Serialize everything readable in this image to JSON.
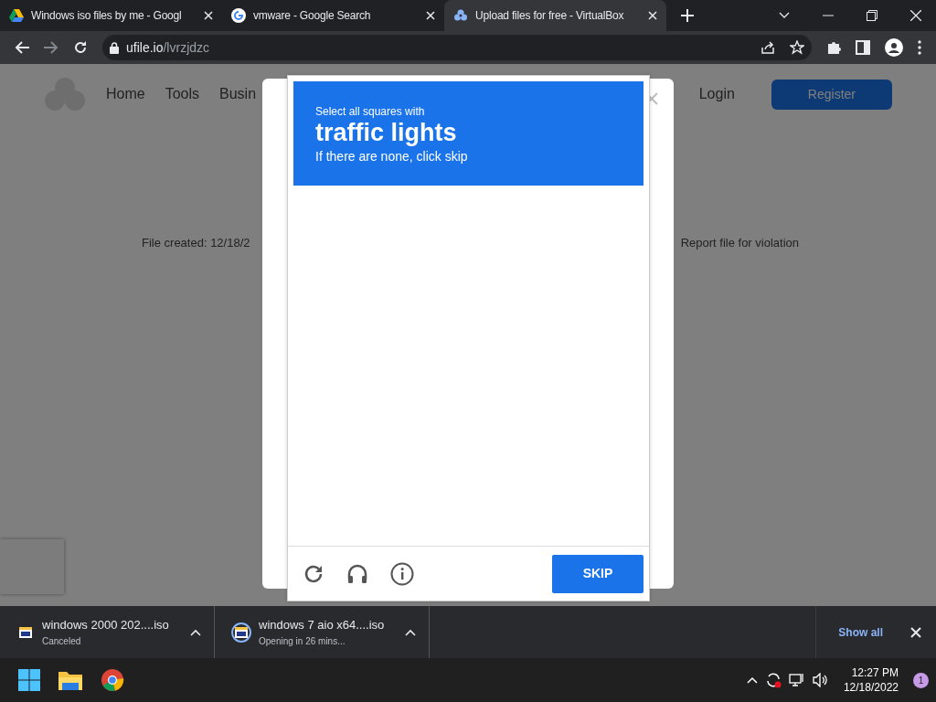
{
  "browser": {
    "tabs": [
      {
        "title": "Windows iso files by me - Googl",
        "kind": "drive",
        "selected": false
      },
      {
        "title": "vmware - Google Search",
        "kind": "google",
        "selected": false
      },
      {
        "title": "Upload files for free - VirtualBox",
        "kind": "ufile",
        "selected": true
      }
    ],
    "address": {
      "host": "ufile.io",
      "path": "/lvrzjdzc"
    }
  },
  "site": {
    "nav": [
      "Home",
      "Tools",
      "Busin"
    ],
    "login": "Login",
    "register": "Register",
    "file_info": "File created: 12/18/2",
    "report": "Report file for violation"
  },
  "captcha": {
    "prompt": "Select all squares with",
    "target": "traffic lights",
    "hint": "If there are none, click skip",
    "button": "SKIP"
  },
  "downloads": [
    {
      "name": "windows 2000 202....iso",
      "status": "Canceled",
      "kind": "canceled"
    },
    {
      "name": "windows 7 aio x64....iso",
      "status": "Opening in 26 mins...",
      "kind": "in_progress"
    }
  ],
  "show_all": "Show all",
  "taskbar": {
    "time": "12:27 PM",
    "date": "12/18/2022",
    "notifications": "1"
  }
}
